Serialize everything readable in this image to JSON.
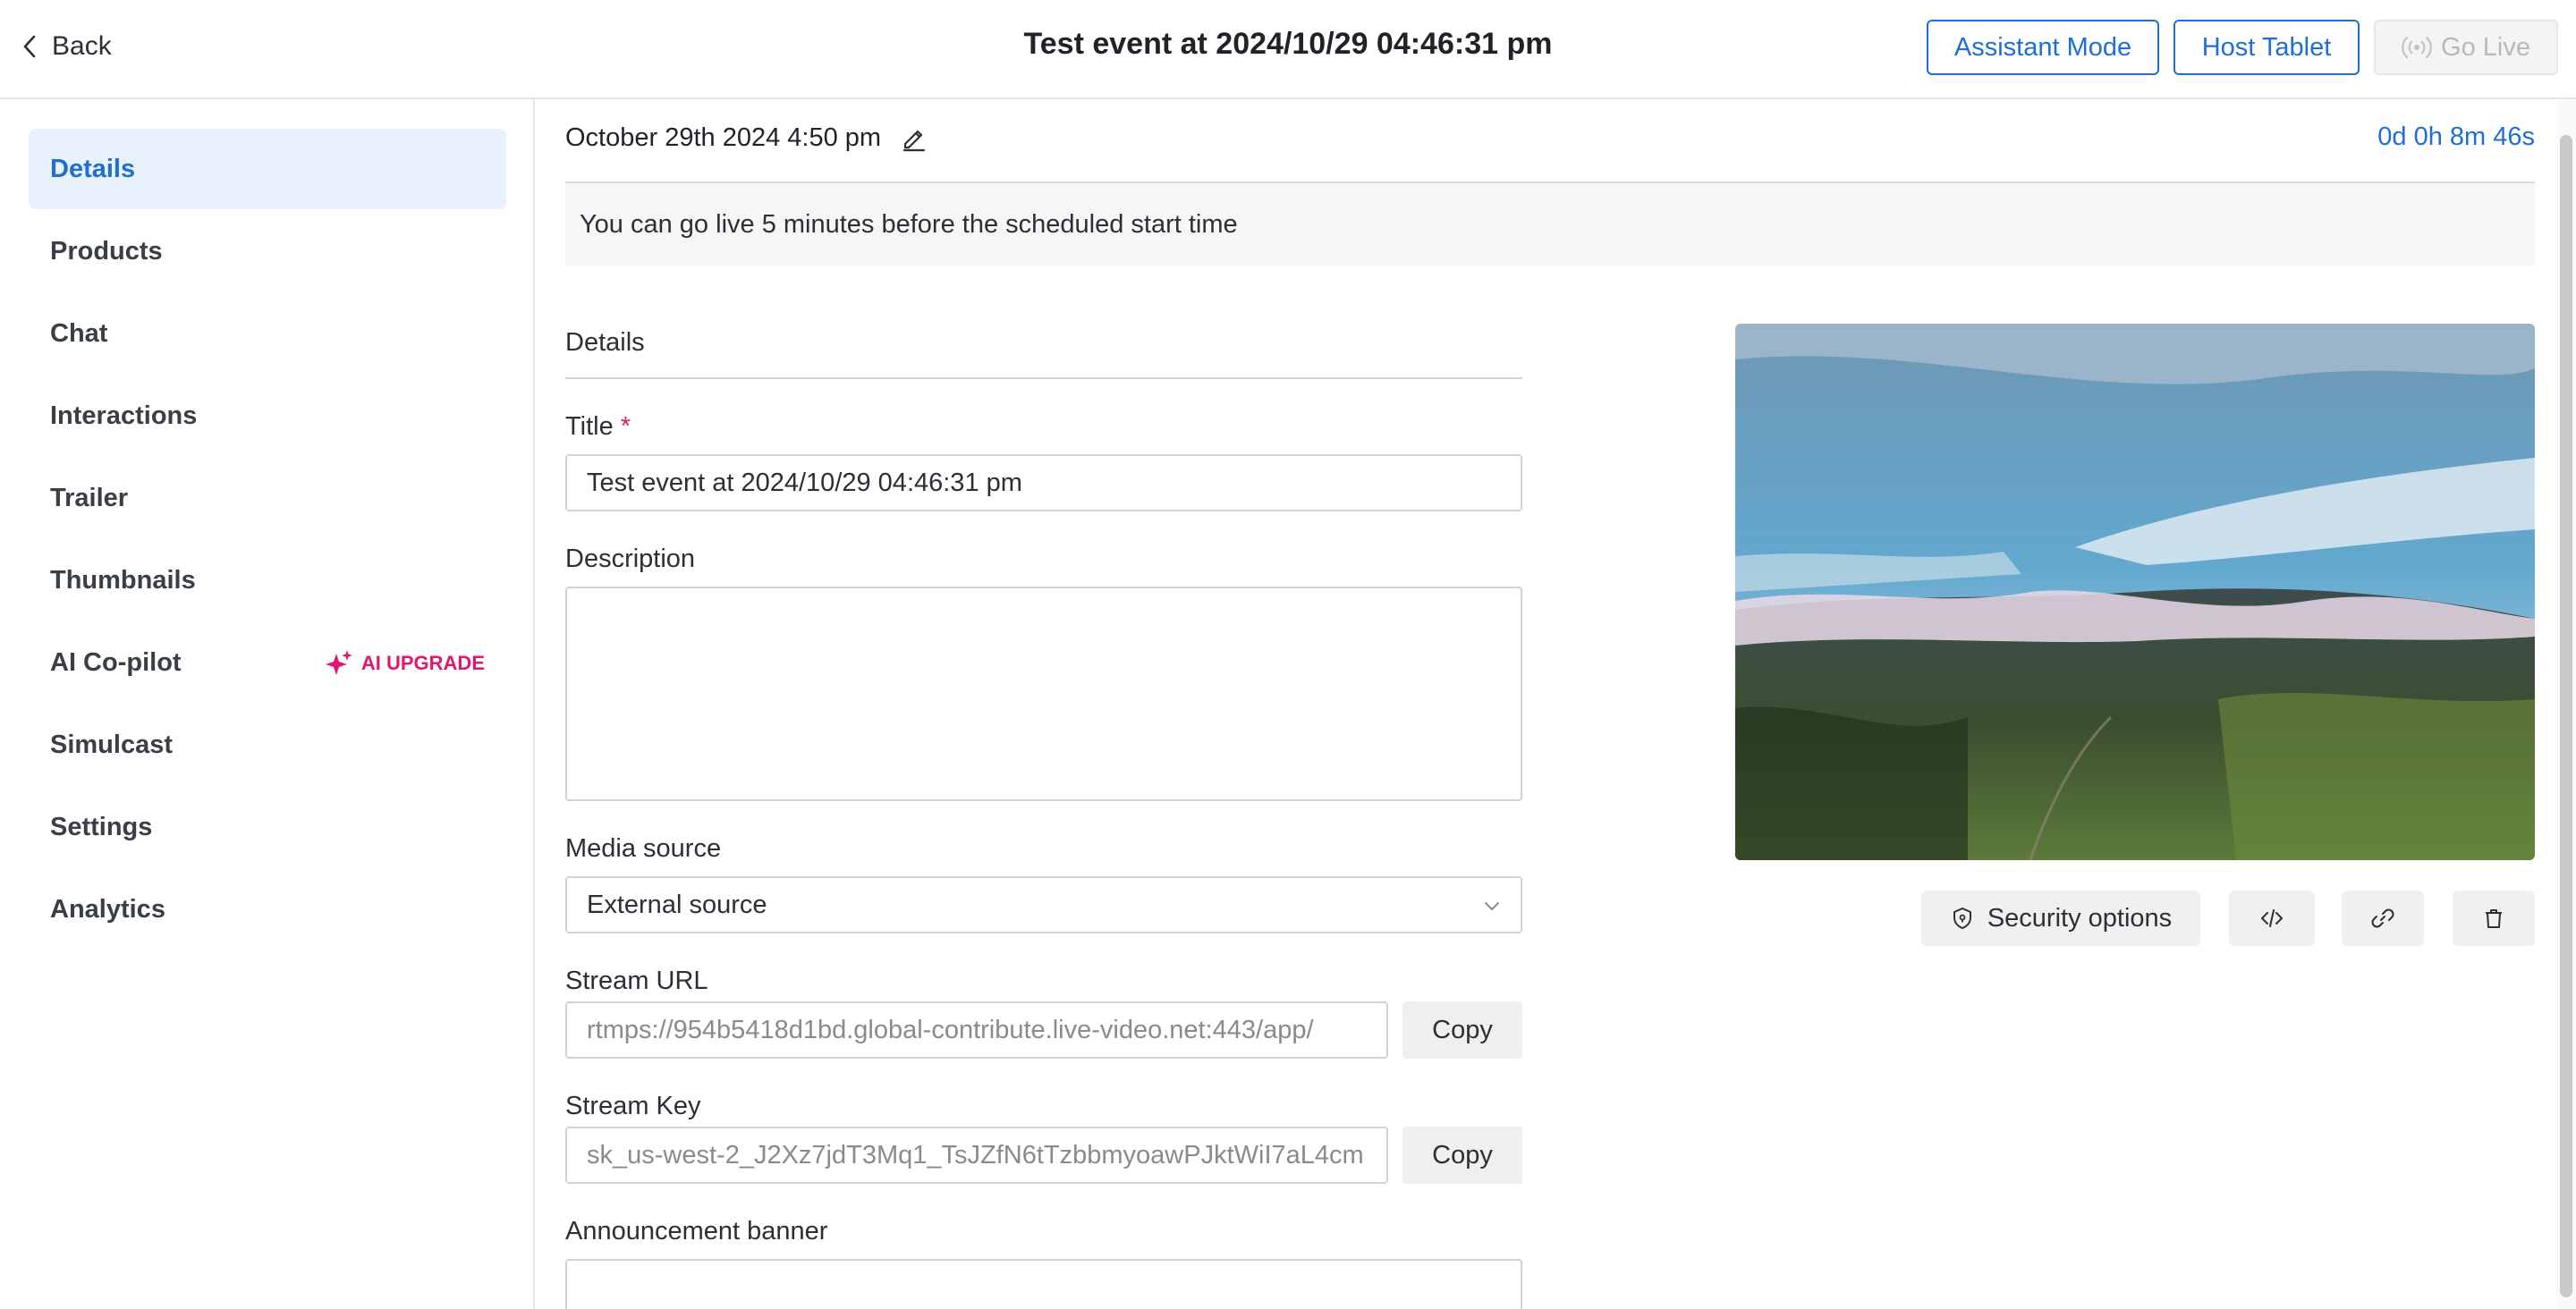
{
  "header": {
    "back_label": "Back",
    "title": "Test event at 2024/10/29 04:46:31 pm",
    "assistant_mode_label": "Assistant Mode",
    "host_tablet_label": "Host Tablet",
    "go_live_label": "Go Live"
  },
  "sidebar": {
    "items": [
      {
        "label": "Details"
      },
      {
        "label": "Products"
      },
      {
        "label": "Chat"
      },
      {
        "label": "Interactions"
      },
      {
        "label": "Trailer"
      },
      {
        "label": "Thumbnails"
      },
      {
        "label": "AI Co-pilot"
      },
      {
        "label": "Simulcast"
      },
      {
        "label": "Settings"
      },
      {
        "label": "Analytics"
      }
    ],
    "ai_badge": "AI UPGRADE"
  },
  "schedule": {
    "date": "October 29th 2024 4:50 pm",
    "countdown": "0d 0h 8m 46s",
    "notice": "You can go live 5 minutes before the scheduled start time"
  },
  "form": {
    "section_title": "Details",
    "title_label": "Title",
    "title_required": "*",
    "title_value": "Test event at 2024/10/29 04:46:31 pm",
    "description_label": "Description",
    "description_value": "",
    "media_source_label": "Media source",
    "media_source_value": "External source",
    "stream_url_label": "Stream URL",
    "stream_url_value": "rtmps://954b5418d1bd.global-contribute.live-video.net:443/app/",
    "stream_key_label": "Stream Key",
    "stream_key_value": "sk_us-west-2_J2Xz7jdT3Mq1_TsJZfN6tTzbbmyoawPJktWiI7aL4cm",
    "copy_label": "Copy",
    "announcement_label": "Announcement banner"
  },
  "actions": {
    "security_label": "Security options"
  },
  "colors": {
    "accent": "#1f6fd1",
    "ai_pink": "#e0176f"
  }
}
